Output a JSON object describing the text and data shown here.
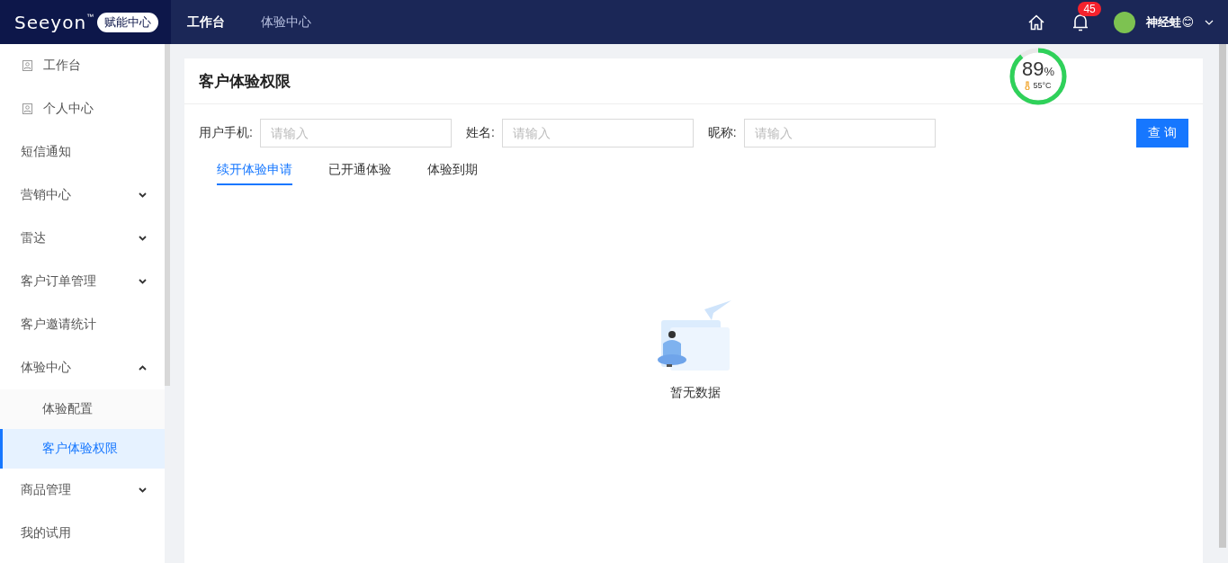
{
  "header": {
    "logo": "Seeyon",
    "trademark": "™",
    "badge": "赋能中心",
    "nav": [
      {
        "label": "工作台",
        "selected": true
      },
      {
        "label": "体验中心",
        "selected": false
      }
    ],
    "notifications": "45",
    "user": "神经蛙😊"
  },
  "gauge": {
    "level": 0.89,
    "value": "89",
    "unit": "%",
    "temperature": "55°C"
  },
  "sidebar": {
    "items": [
      {
        "kind": "page",
        "label": "工作台",
        "selected": false
      },
      {
        "kind": "page",
        "label": "个人中心",
        "selected": false
      },
      {
        "kind": "link",
        "label": "短信通知",
        "selected": false
      },
      {
        "kind": "group",
        "label": "营销中心",
        "expanded": false,
        "selected": false
      },
      {
        "kind": "group",
        "label": "雷达",
        "expanded": false,
        "selected": false
      },
      {
        "kind": "group",
        "label": "客户订单管理",
        "expanded": false,
        "selected": false
      },
      {
        "kind": "link",
        "label": "客户邀请统计",
        "selected": false
      },
      {
        "kind": "group",
        "label": "体验中心",
        "expanded": true,
        "selected": false,
        "children": [
          {
            "label": "体验配置",
            "selected": false
          },
          {
            "label": "客户体验权限",
            "selected": true
          }
        ]
      },
      {
        "kind": "group",
        "label": "商品管理",
        "expanded": false,
        "selected": false
      },
      {
        "kind": "link",
        "label": "我的试用",
        "selected": false
      }
    ]
  },
  "page": {
    "title": "客户体验权限",
    "filters": [
      {
        "label": "用户手机:",
        "placeholder": "请输入"
      },
      {
        "label": "姓名:",
        "placeholder": "请输入"
      },
      {
        "label": "昵称:",
        "placeholder": "请输入"
      }
    ],
    "search_button": "查 询",
    "tabs": [
      {
        "label": "续开体验申请",
        "selected": true
      },
      {
        "label": "已开通体验",
        "selected": false
      },
      {
        "label": "体验到期",
        "selected": false
      }
    ],
    "empty": "暂无数据"
  }
}
